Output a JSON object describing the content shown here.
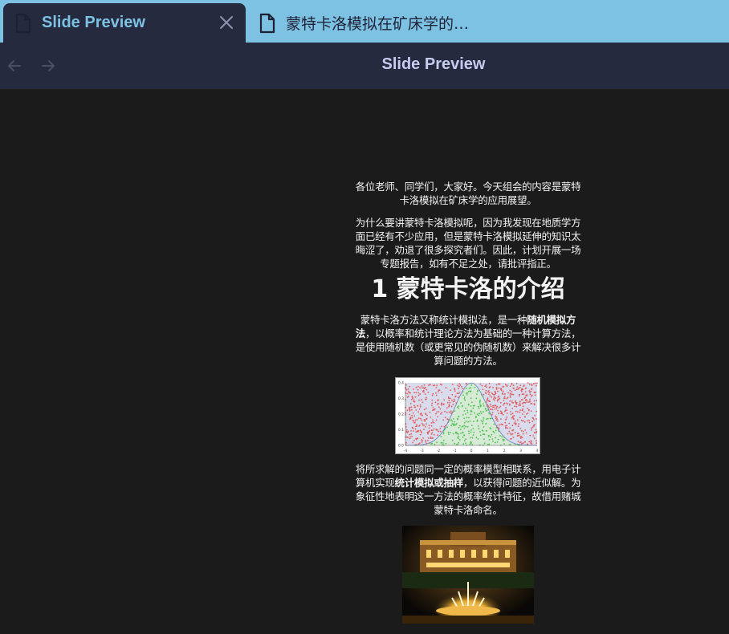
{
  "tabs": [
    {
      "title": "Slide Preview",
      "active": true,
      "icon": "file-icon"
    },
    {
      "title": "蒙特卡洛模拟在矿床学的…",
      "active": false,
      "icon": "file-icon"
    }
  ],
  "toolbar": {
    "title": "Slide Preview",
    "back_icon": "arrow-left-icon",
    "forward_icon": "arrow-right-icon"
  },
  "slide": {
    "intro": "各位老师、同学们，大家好。今天组会的内容是蒙特卡洛模拟在矿床学的应用展望。",
    "motivation": "为什么要讲蒙特卡洛模拟呢，因为我发现在地质学方面已经有不少应用，但是蒙特卡洛模拟延伸的知识太晦涩了，劝退了很多探究者们。因此，计划开展一场专题报告，如有不足之处，请批评指正。",
    "heading": "1 蒙特卡洛的介绍",
    "def_pre": "蒙特卡洛方法又称统计模拟法，是一种",
    "def_bold": "随机模拟方法",
    "def_post": "，以概率和统计理论方法为基础的一种计算方法，是使用随机数（或更常见的伪随机数）来解决很多计算问题的方法。",
    "link_pre": "将所求解的问题同一定的概率模型相联系，用电子计算机实现",
    "link_bold": "统计模拟或抽样",
    "link_post": "，以获得问题的近似解。为象征性地表明这一方法的概率统计特征，故借用赌城蒙特卡洛命名。",
    "photo_icon": "monte-carlo-casino-photo"
  },
  "chart_data": {
    "type": "scatter",
    "x_range": [
      -4,
      4
    ],
    "y_range": [
      0,
      0.4
    ],
    "x_ticks": [
      "-4",
      "-3",
      "-2",
      "-1",
      "0",
      "1",
      "2",
      "3",
      "4"
    ],
    "y_ticks": [
      "0.0",
      "0.1",
      "0.2",
      "0.3",
      "0.4"
    ],
    "curve": "normal pdf",
    "colors": {
      "inside": "#4ec24e",
      "outside": "#e05a5a",
      "fill": "#d9dcec"
    }
  }
}
